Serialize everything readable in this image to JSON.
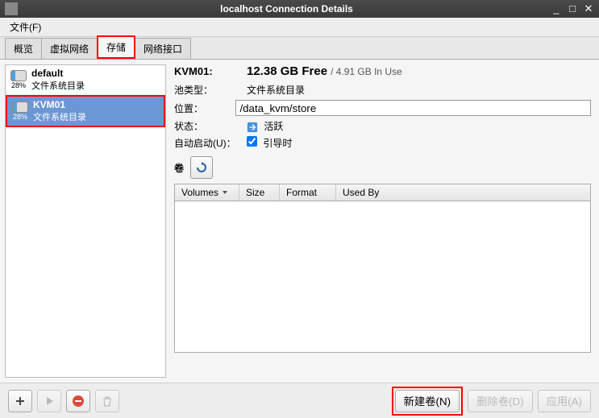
{
  "titlebar": {
    "title": "localhost Connection Details"
  },
  "menubar": {
    "file": "文件(F)"
  },
  "tabs": {
    "overview": "概览",
    "virtual_networks": "虚拟网络",
    "storage": "存储",
    "network_interfaces": "网络接口"
  },
  "sidebar": {
    "pools": [
      {
        "percent": "28%",
        "name": "default",
        "subtitle": "文件系统目录",
        "selected": false
      },
      {
        "percent": "28%",
        "name": "KVM01",
        "subtitle": "文件系统目录",
        "selected": true
      }
    ]
  },
  "details": {
    "pool_title": "KVM01:",
    "free": "12.38 GB Free",
    "in_use": "/ 4.91 GB In Use",
    "pool_type_label": "池类型：",
    "pool_type_value": "文件系统目录",
    "location_label": "位置：",
    "location_value": "/data_kvm/store",
    "state_label": "状态：",
    "state_value": "活跃",
    "autostart_label": "自动启动(U)：",
    "autostart_cb_label": "引导时",
    "volumes_label": "卷",
    "table": {
      "volumes": "Volumes",
      "size": "Size",
      "format": "Format",
      "usedby": "Used By"
    }
  },
  "footer": {
    "new_volume": "新建卷(N)",
    "delete_volume": "删除卷(D)",
    "apply": "应用(A)"
  }
}
